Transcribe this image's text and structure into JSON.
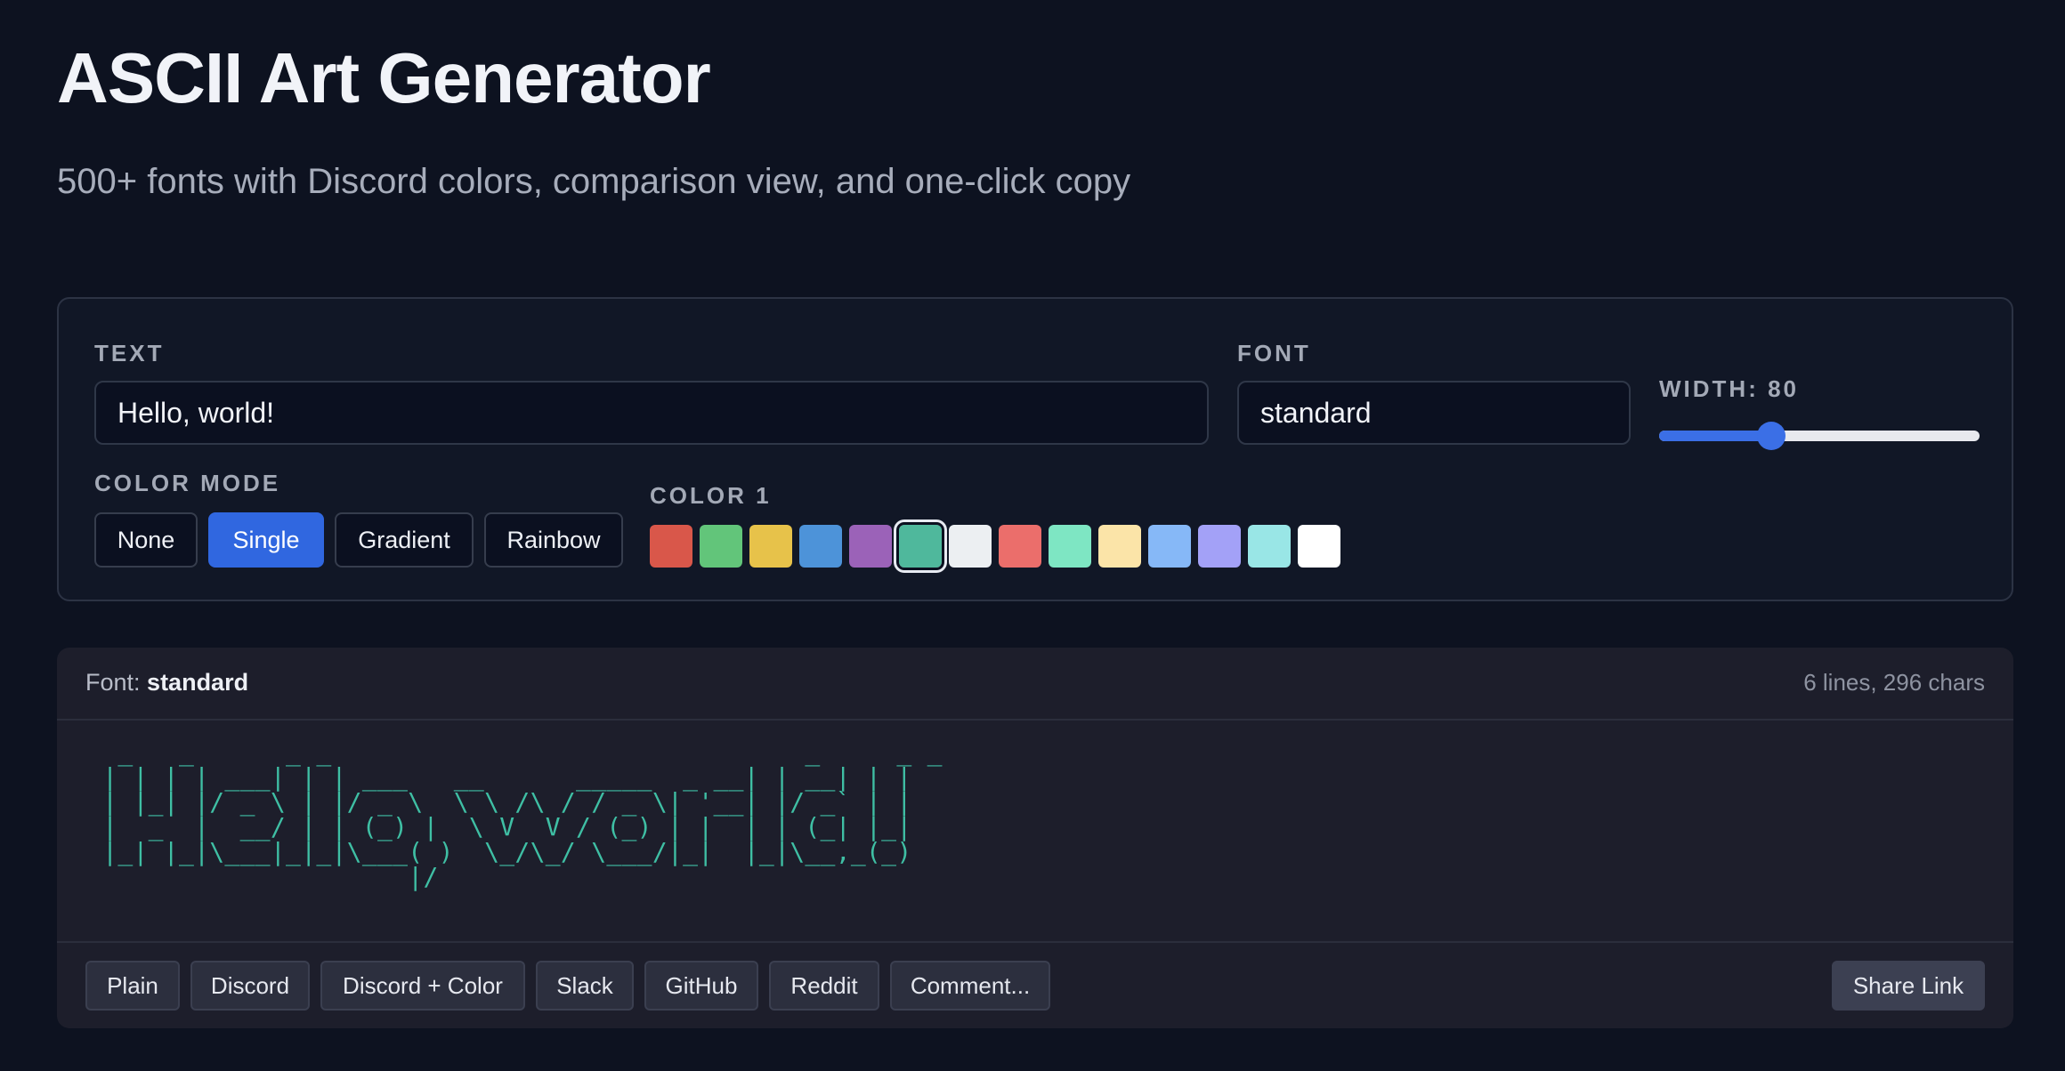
{
  "header": {
    "title": "ASCII Art Generator",
    "subtitle": "500+ fonts with Discord colors, comparison view, and one-click copy"
  },
  "controls": {
    "text_label": "TEXT",
    "text_value": "Hello, world!",
    "font_label": "FONT",
    "font_value": "standard",
    "width_label": "WIDTH: 80",
    "width_value": 80,
    "width_fraction": 0.35,
    "color_mode_label": "COLOR MODE",
    "color_modes": [
      "None",
      "Single",
      "Gradient",
      "Rainbow"
    ],
    "selected_color_mode": "Single",
    "color1_label": "COLOR 1",
    "swatches": [
      "#d9574a",
      "#62c57a",
      "#e7c24a",
      "#4d93d9",
      "#9b62b8",
      "#4fb89c",
      "#eceff2",
      "#eb6e6b",
      "#7ee6c3",
      "#fbe4a8",
      "#86b8f7",
      "#a3a1f7",
      "#99e6e6",
      "#ffffff"
    ],
    "selected_swatch_index": 5
  },
  "output": {
    "font_prefix": "Font:",
    "font_name": "standard",
    "stats": "6 lines, 296 chars",
    "art_color": "#3fbfa4",
    "art": "  _   _      _ _                               _     _ _ \n | | | | ___| | | ___   __      _____  _ __| | __| | |\n | |_| |/ _ \\ | |/ _ \\  \\ \\ /\\ / / _ \\| '__| |/ _` | |\n |  _  |  __/ | | (_) |  \\ V  V / (_) | |  | | (_| |_|\n |_| |_|\\___|_|_|\\___( )  \\_/\\_/ \\___/|_|  |_|\\__,_(_)\n                     |/                                ",
    "copy_buttons": [
      "Plain",
      "Discord",
      "Discord + Color",
      "Slack",
      "GitHub",
      "Reddit",
      "Comment..."
    ],
    "share_label": "Share Link"
  }
}
